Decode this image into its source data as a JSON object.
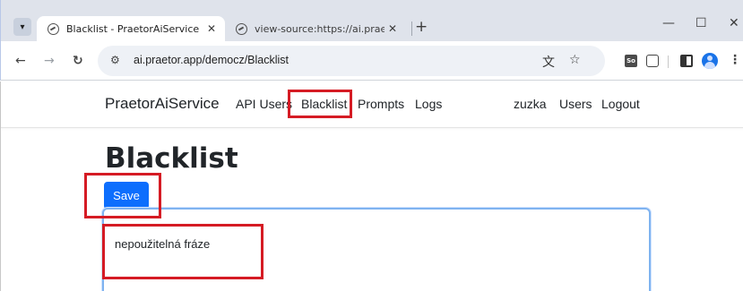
{
  "browser": {
    "tabs": [
      {
        "title": "Blacklist - PraetorAiService",
        "active": true
      },
      {
        "title": "view-source:https://ai.praetor.a",
        "active": false
      }
    ],
    "url": "ai.praetor.app/democz/Blacklist",
    "window_controls": {
      "minimize": "—",
      "maximize": "☐",
      "close": "✕"
    }
  },
  "navbar": {
    "brand": "PraetorAiService",
    "links": [
      "API Users",
      "Blacklist",
      "Prompts",
      "Logs"
    ],
    "user": "zuzka",
    "right_links": [
      "Users",
      "Logout"
    ]
  },
  "page": {
    "title": "Blacklist",
    "save_label": "Save",
    "blacklist_text": "nepoužitelná fráze"
  },
  "colors": {
    "primary": "#0d6efd",
    "highlight": "#d51b24",
    "focus_border": "#7fb3f0"
  }
}
